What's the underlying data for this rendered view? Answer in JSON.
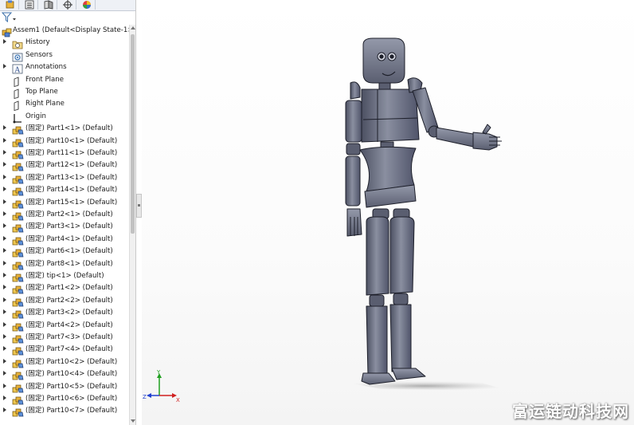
{
  "feature_tree": {
    "root_label": "Assem1  (Default<Display State-1>",
    "items": [
      {
        "label": "History",
        "icon": "history-folder-icon",
        "expand": true
      },
      {
        "label": "Sensors",
        "icon": "sensors-icon",
        "expand": false
      },
      {
        "label": "Annotations",
        "icon": "annotations-icon",
        "expand": true
      },
      {
        "label": "Front Plane",
        "icon": "plane-icon",
        "expand": false
      },
      {
        "label": "Top Plane",
        "icon": "plane-icon",
        "expand": false
      },
      {
        "label": "Right Plane",
        "icon": "plane-icon",
        "expand": false
      },
      {
        "label": "Origin",
        "icon": "origin-icon",
        "expand": false
      },
      {
        "label": "(固定) Part1<1> (Default)",
        "icon": "part-icon",
        "expand": true
      },
      {
        "label": "(固定) Part10<1> (Default)",
        "icon": "part-icon",
        "expand": true
      },
      {
        "label": "(固定) Part11<1> (Default)",
        "icon": "part-icon",
        "expand": true
      },
      {
        "label": "(固定) Part12<1> (Default)",
        "icon": "part-icon",
        "expand": true
      },
      {
        "label": "(固定) Part13<1> (Default)",
        "icon": "part-icon",
        "expand": true
      },
      {
        "label": "(固定) Part14<1> (Default)",
        "icon": "part-icon",
        "expand": true
      },
      {
        "label": "(固定) Part15<1> (Default)",
        "icon": "part-icon",
        "expand": true
      },
      {
        "label": "(固定) Part2<1> (Default)",
        "icon": "part-icon",
        "expand": true
      },
      {
        "label": "(固定) Part3<1> (Default)",
        "icon": "part-icon",
        "expand": true
      },
      {
        "label": "(固定) Part4<1> (Default)",
        "icon": "part-icon",
        "expand": true
      },
      {
        "label": "(固定) Part6<1> (Default)",
        "icon": "part-icon",
        "expand": true
      },
      {
        "label": "(固定) Part8<1> (Default)",
        "icon": "part-icon",
        "expand": true
      },
      {
        "label": "(固定) tip<1> (Default)",
        "icon": "part-icon",
        "expand": true
      },
      {
        "label": "(固定) Part1<2> (Default)",
        "icon": "part-icon",
        "expand": true
      },
      {
        "label": "(固定) Part2<2> (Default)",
        "icon": "part-icon",
        "expand": true
      },
      {
        "label": "(固定) Part3<2> (Default)",
        "icon": "part-icon",
        "expand": true
      },
      {
        "label": "(固定) Part4<2> (Default)",
        "icon": "part-icon",
        "expand": true
      },
      {
        "label": "(固定) Part7<3> (Default)",
        "icon": "part-icon",
        "expand": true
      },
      {
        "label": "(固定) Part7<4> (Default)",
        "icon": "part-icon",
        "expand": true
      },
      {
        "label": "(固定) Part10<2> (Default)",
        "icon": "part-icon",
        "expand": true
      },
      {
        "label": "(固定) Part10<4> (Default)",
        "icon": "part-icon",
        "expand": true
      },
      {
        "label": "(固定) Part10<5> (Default)",
        "icon": "part-icon",
        "expand": true
      },
      {
        "label": "(固定) Part10<6> (Default)",
        "icon": "part-icon",
        "expand": true
      },
      {
        "label": "(固定) Part10<7> (Default)",
        "icon": "part-icon",
        "expand": true
      }
    ]
  },
  "triad": {
    "x_label": "X",
    "y_label": "Y",
    "z_label": "Z"
  },
  "watermark": "富运链动科技网",
  "colors": {
    "robot_fill": "#6b7080",
    "robot_edge": "#1d1f2a",
    "axis_x": "#d02020",
    "axis_y": "#20a020",
    "axis_z": "#2040d0"
  }
}
